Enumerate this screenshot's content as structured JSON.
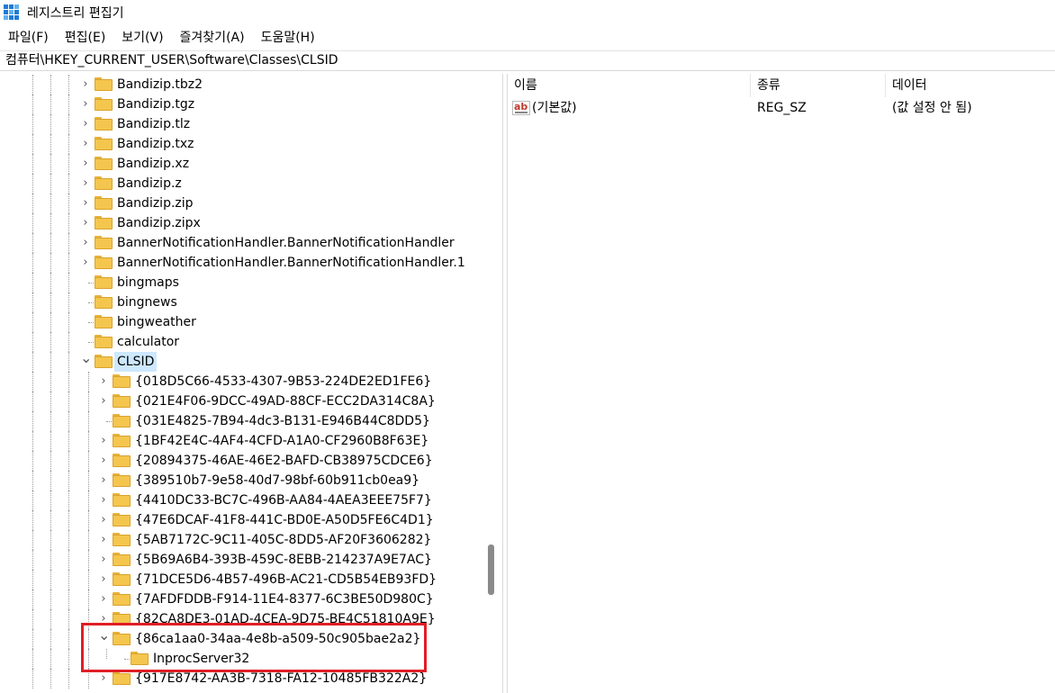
{
  "window": {
    "title": "레지스트리 편집기"
  },
  "menu": [
    "파일(F)",
    "편집(E)",
    "보기(V)",
    "즐겨찾기(A)",
    "도움말(H)"
  ],
  "address": "컴퓨터\\HKEY_CURRENT_USER\\Software\\Classes\\CLSID",
  "tree": {
    "items": [
      {
        "label": "Bandizip.tbz2",
        "expander": ">"
      },
      {
        "label": "Bandizip.tgz",
        "expander": ">"
      },
      {
        "label": "Bandizip.tlz",
        "expander": ">"
      },
      {
        "label": "Bandizip.txz",
        "expander": ">"
      },
      {
        "label": "Bandizip.xz",
        "expander": ">"
      },
      {
        "label": "Bandizip.z",
        "expander": ">"
      },
      {
        "label": "Bandizip.zip",
        "expander": ">"
      },
      {
        "label": "Bandizip.zipx",
        "expander": ">"
      },
      {
        "label": "BannerNotificationHandler.BannerNotificationHandler",
        "expander": ">"
      },
      {
        "label": "BannerNotificationHandler.BannerNotificationHandler.1",
        "expander": ">"
      },
      {
        "label": "bingmaps",
        "expander": ""
      },
      {
        "label": "bingnews",
        "expander": ""
      },
      {
        "label": "bingweather",
        "expander": ""
      },
      {
        "label": "calculator",
        "expander": ""
      },
      {
        "label": "CLSID",
        "expander": "v"
      },
      {
        "label": "{018D5C66-4533-4307-9B53-224DE2ED1FE6}",
        "expander": ">"
      },
      {
        "label": "{021E4F06-9DCC-49AD-88CF-ECC2DA314C8A}",
        "expander": ">"
      },
      {
        "label": "{031E4825-7B94-4dc3-B131-E946B44C8DD5}",
        "expander": ""
      },
      {
        "label": "{1BF42E4C-4AF4-4CFD-A1A0-CF2960B8F63E}",
        "expander": ">"
      },
      {
        "label": "{20894375-46AE-46E2-BAFD-CB38975CDCE6}",
        "expander": ">"
      },
      {
        "label": "{389510b7-9e58-40d7-98bf-60b911cb0ea9}",
        "expander": ">"
      },
      {
        "label": "{4410DC33-BC7C-496B-AA84-4AEA3EEE75F7}",
        "expander": ">"
      },
      {
        "label": "{47E6DCAF-41F8-441C-BD0E-A50D5FE6C4D1}",
        "expander": ">"
      },
      {
        "label": "{5AB7172C-9C11-405C-8DD5-AF20F3606282}",
        "expander": ">"
      },
      {
        "label": "{5B69A6B4-393B-459C-8EBB-214237A9E7AC}",
        "expander": ">"
      },
      {
        "label": "{71DCE5D6-4B57-496B-AC21-CD5B54EB93FD}",
        "expander": ">"
      },
      {
        "label": "{7AFDFDDB-F914-11E4-8377-6C3BE50D980C}",
        "expander": ">"
      },
      {
        "label": "{82CA8DE3-01AD-4CEA-9D75-BE4C51810A9E}",
        "expander": ">"
      },
      {
        "label": "{86ca1aa0-34aa-4e8b-a509-50c905bae2a2}",
        "expander": "v"
      },
      {
        "label": "InprocServer32",
        "expander": ""
      },
      {
        "label": "{917E8742-AA3B-7318-FA12-10485FB322A2}",
        "expander": ">"
      }
    ]
  },
  "list": {
    "columns": [
      "이름",
      "종류",
      "데이터"
    ],
    "rows": [
      {
        "name": "(기본값)",
        "type": "REG_SZ",
        "data": "(값 설정 안 됨)"
      }
    ]
  },
  "colors": {
    "selection": "#cde8ff",
    "folder": "#f5c64d",
    "highlight_box": "#e01e25"
  }
}
